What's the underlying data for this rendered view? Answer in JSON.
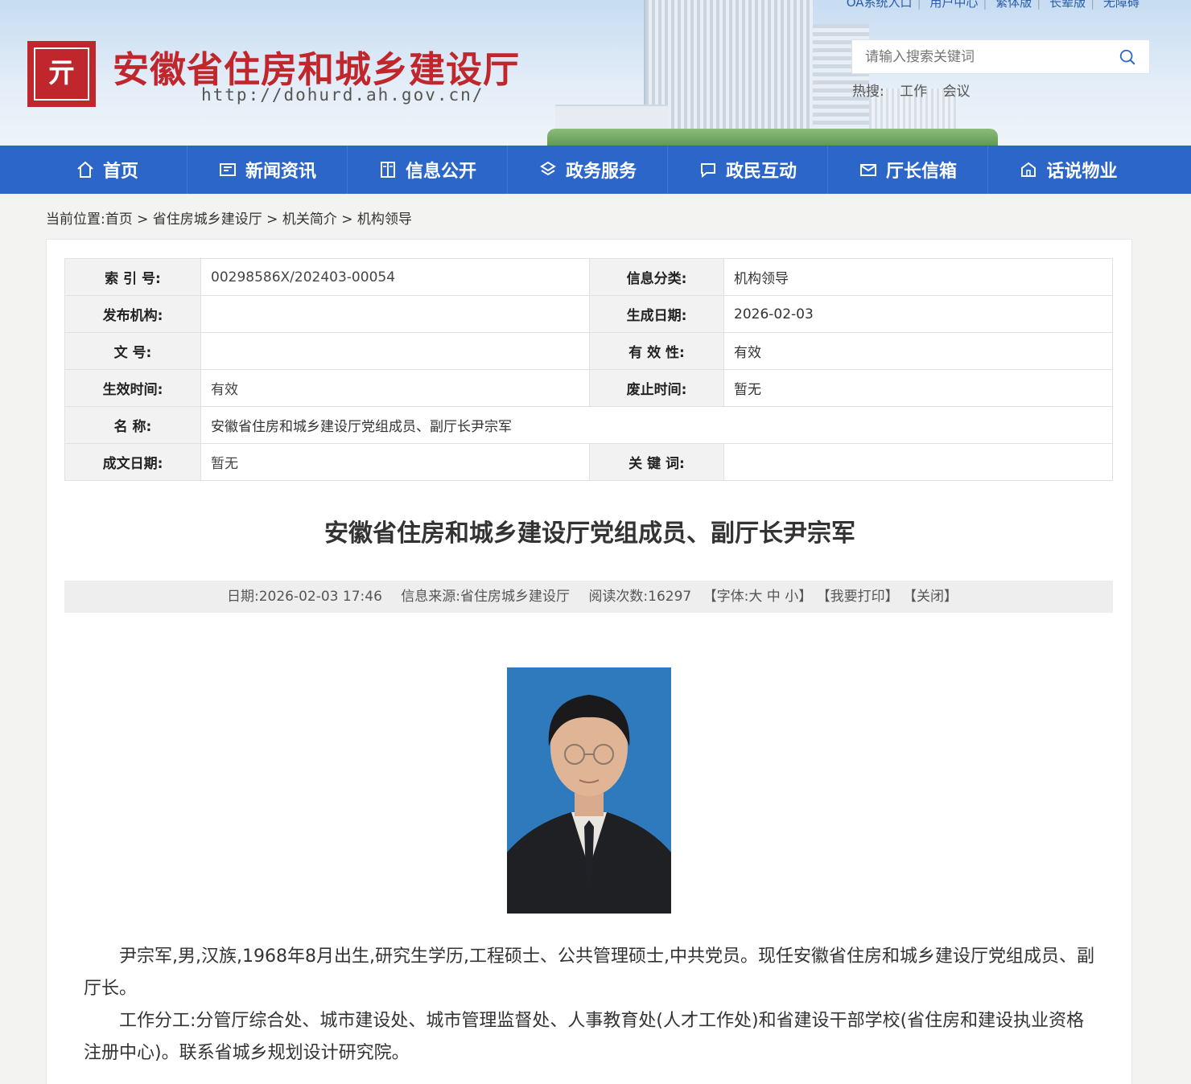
{
  "header": {
    "top_links": [
      "OA系统入口",
      "用户中心",
      "繁体版",
      "长辈版",
      "无障碍"
    ],
    "site_title": "安徽省住房和城乡建设厅",
    "site_url": "http://dohurd.ah.gov.cn/",
    "search_placeholder": "请输入搜索关键词",
    "hot_label": "热搜:",
    "hot_terms": [
      "工作",
      "会议"
    ]
  },
  "nav": [
    {
      "label": "首页",
      "icon": "home-icon"
    },
    {
      "label": "新闻资讯",
      "icon": "newspaper-icon"
    },
    {
      "label": "信息公开",
      "icon": "book-icon"
    },
    {
      "label": "政务服务",
      "icon": "service-icon"
    },
    {
      "label": "政民互动",
      "icon": "chat-icon"
    },
    {
      "label": "厅长信箱",
      "icon": "mailbox-icon"
    },
    {
      "label": "话说物业",
      "icon": "property-icon"
    }
  ],
  "breadcrumb": "当前位置:首页 > 省住房城乡建设厅 > 机关简介 > 机构领导",
  "meta": {
    "index_label": "索 引 号:",
    "index_value": "00298586X/202403-00054",
    "category_label": "信息分类:",
    "category_value": "机构领导",
    "publisher_label": "发布机构:",
    "publisher_value": "",
    "created_label": "生成日期:",
    "created_value": "2026-02-03",
    "docno_label": "文 号:",
    "docno_value": "",
    "validity_label": "有 效 性:",
    "validity_value": "有效",
    "effective_label": "生效时间:",
    "effective_value": "有效",
    "abolish_label": "废止时间:",
    "abolish_value": "暂无",
    "name_label": "名 称:",
    "name_value": "安徽省住房和城乡建设厅党组成员、副厅长尹宗军",
    "written_label": "成文日期:",
    "written_value": "暂无",
    "keywords_label": "关 键 词:",
    "keywords_value": ""
  },
  "article": {
    "title": "安徽省住房和城乡建设厅党组成员、副厅长尹宗军",
    "date": "日期:2026-02-03 17:46",
    "source": "信息来源:省住房城乡建设厅",
    "reads": "阅读次数:16297",
    "font": "【字体:大 中 小】",
    "print": "【我要打印】",
    "close": "【关闭】",
    "para1": "尹宗军,男,汉族,1968年8月出生,研究生学历,工程硕士、公共管理硕士,中共党员。现任安徽省住房和城乡建设厅党组成员、副厅长。",
    "para2": "工作分工:分管厅综合处、城市建设处、城市管理监督处、人事教育处(人才工作处)和省建设干部学校(省住房和建设执业资格注册中心)。联系省城乡规划设计研究院。"
  }
}
